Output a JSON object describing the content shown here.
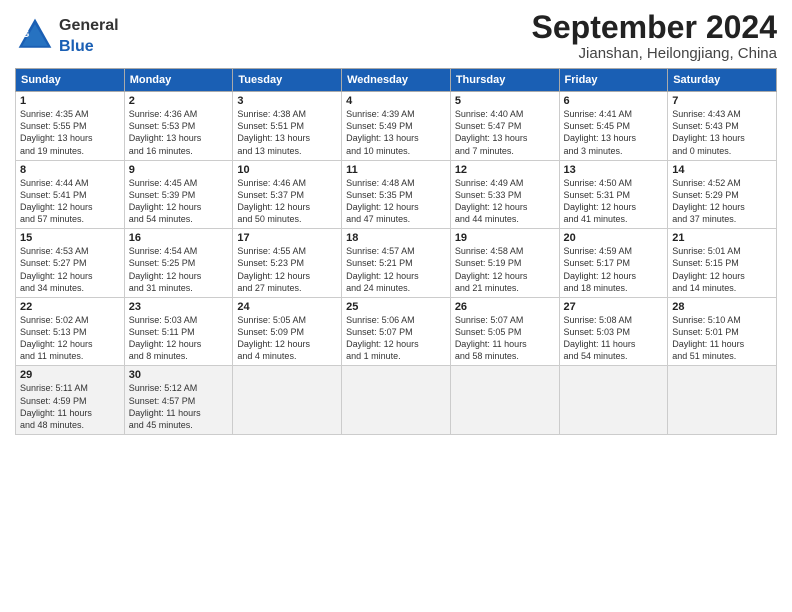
{
  "header": {
    "logo_text_general": "General",
    "logo_text_blue": "Blue",
    "month_title": "September 2024",
    "location": "Jianshan, Heilongjiang, China"
  },
  "weekdays": [
    "Sunday",
    "Monday",
    "Tuesday",
    "Wednesday",
    "Thursday",
    "Friday",
    "Saturday"
  ],
  "weeks": [
    [
      {
        "day": "1",
        "info": "Sunrise: 4:35 AM\nSunset: 5:55 PM\nDaylight: 13 hours\nand 19 minutes."
      },
      {
        "day": "2",
        "info": "Sunrise: 4:36 AM\nSunset: 5:53 PM\nDaylight: 13 hours\nand 16 minutes."
      },
      {
        "day": "3",
        "info": "Sunrise: 4:38 AM\nSunset: 5:51 PM\nDaylight: 13 hours\nand 13 minutes."
      },
      {
        "day": "4",
        "info": "Sunrise: 4:39 AM\nSunset: 5:49 PM\nDaylight: 13 hours\nand 10 minutes."
      },
      {
        "day": "5",
        "info": "Sunrise: 4:40 AM\nSunset: 5:47 PM\nDaylight: 13 hours\nand 7 minutes."
      },
      {
        "day": "6",
        "info": "Sunrise: 4:41 AM\nSunset: 5:45 PM\nDaylight: 13 hours\nand 3 minutes."
      },
      {
        "day": "7",
        "info": "Sunrise: 4:43 AM\nSunset: 5:43 PM\nDaylight: 13 hours\nand 0 minutes."
      }
    ],
    [
      {
        "day": "8",
        "info": "Sunrise: 4:44 AM\nSunset: 5:41 PM\nDaylight: 12 hours\nand 57 minutes."
      },
      {
        "day": "9",
        "info": "Sunrise: 4:45 AM\nSunset: 5:39 PM\nDaylight: 12 hours\nand 54 minutes."
      },
      {
        "day": "10",
        "info": "Sunrise: 4:46 AM\nSunset: 5:37 PM\nDaylight: 12 hours\nand 50 minutes."
      },
      {
        "day": "11",
        "info": "Sunrise: 4:48 AM\nSunset: 5:35 PM\nDaylight: 12 hours\nand 47 minutes."
      },
      {
        "day": "12",
        "info": "Sunrise: 4:49 AM\nSunset: 5:33 PM\nDaylight: 12 hours\nand 44 minutes."
      },
      {
        "day": "13",
        "info": "Sunrise: 4:50 AM\nSunset: 5:31 PM\nDaylight: 12 hours\nand 41 minutes."
      },
      {
        "day": "14",
        "info": "Sunrise: 4:52 AM\nSunset: 5:29 PM\nDaylight: 12 hours\nand 37 minutes."
      }
    ],
    [
      {
        "day": "15",
        "info": "Sunrise: 4:53 AM\nSunset: 5:27 PM\nDaylight: 12 hours\nand 34 minutes."
      },
      {
        "day": "16",
        "info": "Sunrise: 4:54 AM\nSunset: 5:25 PM\nDaylight: 12 hours\nand 31 minutes."
      },
      {
        "day": "17",
        "info": "Sunrise: 4:55 AM\nSunset: 5:23 PM\nDaylight: 12 hours\nand 27 minutes."
      },
      {
        "day": "18",
        "info": "Sunrise: 4:57 AM\nSunset: 5:21 PM\nDaylight: 12 hours\nand 24 minutes."
      },
      {
        "day": "19",
        "info": "Sunrise: 4:58 AM\nSunset: 5:19 PM\nDaylight: 12 hours\nand 21 minutes."
      },
      {
        "day": "20",
        "info": "Sunrise: 4:59 AM\nSunset: 5:17 PM\nDaylight: 12 hours\nand 18 minutes."
      },
      {
        "day": "21",
        "info": "Sunrise: 5:01 AM\nSunset: 5:15 PM\nDaylight: 12 hours\nand 14 minutes."
      }
    ],
    [
      {
        "day": "22",
        "info": "Sunrise: 5:02 AM\nSunset: 5:13 PM\nDaylight: 12 hours\nand 11 minutes."
      },
      {
        "day": "23",
        "info": "Sunrise: 5:03 AM\nSunset: 5:11 PM\nDaylight: 12 hours\nand 8 minutes."
      },
      {
        "day": "24",
        "info": "Sunrise: 5:05 AM\nSunset: 5:09 PM\nDaylight: 12 hours\nand 4 minutes."
      },
      {
        "day": "25",
        "info": "Sunrise: 5:06 AM\nSunset: 5:07 PM\nDaylight: 12 hours\nand 1 minute."
      },
      {
        "day": "26",
        "info": "Sunrise: 5:07 AM\nSunset: 5:05 PM\nDaylight: 11 hours\nand 58 minutes."
      },
      {
        "day": "27",
        "info": "Sunrise: 5:08 AM\nSunset: 5:03 PM\nDaylight: 11 hours\nand 54 minutes."
      },
      {
        "day": "28",
        "info": "Sunrise: 5:10 AM\nSunset: 5:01 PM\nDaylight: 11 hours\nand 51 minutes."
      }
    ],
    [
      {
        "day": "29",
        "info": "Sunrise: 5:11 AM\nSunset: 4:59 PM\nDaylight: 11 hours\nand 48 minutes."
      },
      {
        "day": "30",
        "info": "Sunrise: 5:12 AM\nSunset: 4:57 PM\nDaylight: 11 hours\nand 45 minutes."
      },
      {
        "day": "",
        "info": ""
      },
      {
        "day": "",
        "info": ""
      },
      {
        "day": "",
        "info": ""
      },
      {
        "day": "",
        "info": ""
      },
      {
        "day": "",
        "info": ""
      }
    ]
  ]
}
